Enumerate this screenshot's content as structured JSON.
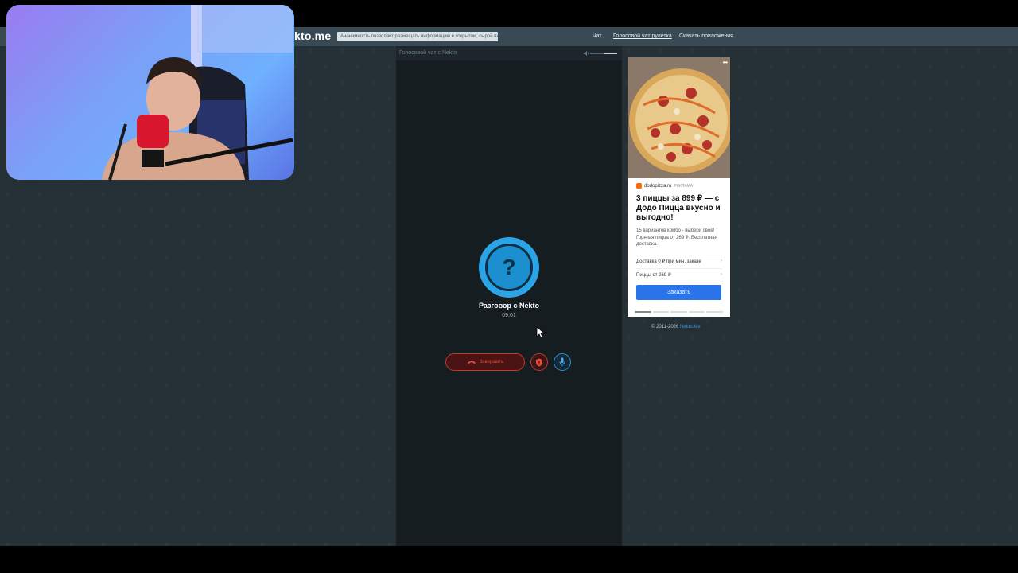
{
  "site": {
    "logo_text": "ekto.me",
    "notice_text": "Анонимность позволяет размещать информацию в открытом, сырой виде!",
    "nav": [
      {
        "label": "Чат"
      },
      {
        "label": "Голосовой чат рулетка"
      },
      {
        "label": "Скачать приложения"
      }
    ]
  },
  "chat": {
    "header_title": "Голосовой чат с Nekto",
    "avatar_symbol": "?",
    "call_title": "Разговор с Nekto",
    "call_timer": "09:01",
    "end_button_label": "Завершить",
    "accent_color": "#2aa4e5",
    "end_color": "#e74c3c"
  },
  "ad": {
    "source": "dodopizza.ru",
    "tag": "РЕКЛАМА",
    "headline": "3 пиццы за 899 ₽ — с Додо Пицца вкусно и выгодно!",
    "body": "15 вариантов комбо - выбери свое! Горячая пицца от 269 ₽. Бесплатная доставка.",
    "rows": [
      {
        "label": "Доставка 0 ₽ при мин. заказе"
      },
      {
        "label": "Пиццы от 269 ₽"
      }
    ],
    "order_label": "Заказать",
    "brand_color": "#ff6900",
    "button_color": "#2a73e8"
  },
  "footer": {
    "copyright": "© 2011-2026",
    "link": "Nekto.Me"
  }
}
